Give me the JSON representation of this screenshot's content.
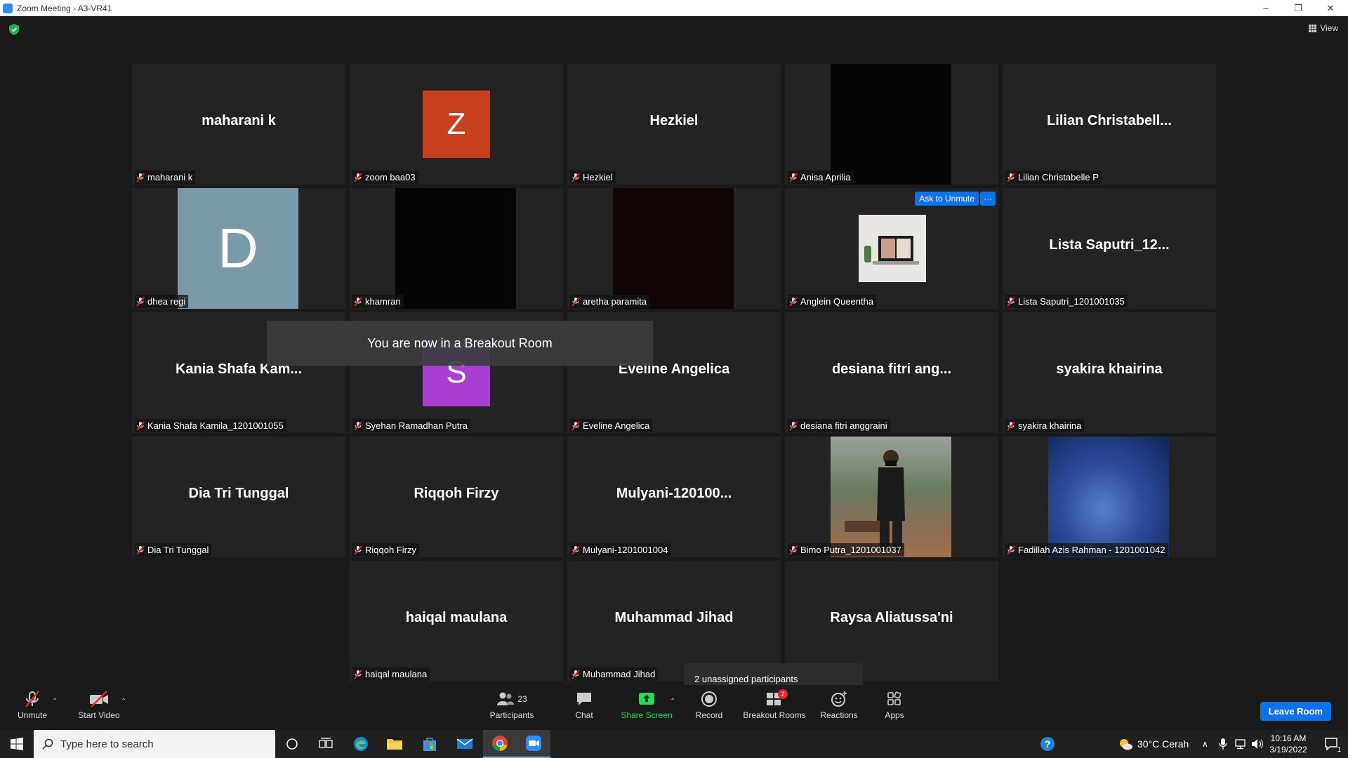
{
  "window": {
    "title": "Zoom Meeting - A3-VR41",
    "controls": {
      "minimize": "–",
      "restore": "❐",
      "close": "✕"
    }
  },
  "top": {
    "view_label": "View"
  },
  "tiles": [
    {
      "big_name": "maharani k",
      "label": "maharani k",
      "avatar": null
    },
    {
      "big_name": "",
      "label": "zoom baa03",
      "avatar": {
        "letter": "Z",
        "color": "#c8401b"
      }
    },
    {
      "big_name": "Hezkiel",
      "label": "Hezkiel",
      "avatar": null
    },
    {
      "big_name": "",
      "label": "Anisa Aprilia",
      "video": "black"
    },
    {
      "big_name": "Lilian  Christabell...",
      "label": "Lilian Christabelle P",
      "avatar": null
    },
    {
      "big_name": "",
      "label": "dhea regi",
      "avatar": {
        "letter": "D",
        "color": "#7a9aa8"
      }
    },
    {
      "big_name": "",
      "label": "khamran",
      "video": "black"
    },
    {
      "big_name": "",
      "label": "aretha paramita",
      "video": "darkred"
    },
    {
      "big_name": "",
      "label": "Anglein Queentha",
      "video": "laptop",
      "ask_unmute": "Ask to Unmute",
      "more": "···"
    },
    {
      "big_name": "Lista  Saputri_12...",
      "label": "Lista Saputri_1201001035",
      "avatar": null
    },
    {
      "big_name": "Kania  Shafa  Kam...",
      "label": "Kania Shafa Kamila_1201001055",
      "avatar": null
    },
    {
      "big_name": "",
      "label": "Syehan Ramadhan Putra",
      "avatar": {
        "letter": "S",
        "color": "#a83fd0"
      }
    },
    {
      "big_name": "Eveline Angelica",
      "label": "Eveline Angelica",
      "avatar": null
    },
    {
      "big_name": "desiana fitri ang...",
      "label": "desiana fitri anggraini",
      "avatar": null
    },
    {
      "big_name": "syakira khairina",
      "label": "syakira khairina",
      "avatar": null
    },
    {
      "big_name": "Dia Tri Tunggal",
      "label": "Dia Tri Tunggal",
      "avatar": null
    },
    {
      "big_name": "Riqqoh Firzy",
      "label": "Riqqoh Firzy",
      "avatar": null
    },
    {
      "big_name": "Mulyani-120100...",
      "label": "Mulyani-1201001004",
      "avatar": null
    },
    {
      "big_name": "",
      "label": "Bimo Putra_1201001037",
      "video": "person"
    },
    {
      "big_name": "",
      "label": "Fadillah Azis Rahman - 1201001042",
      "video": "blue"
    },
    {
      "big_name": "haiqal maulana",
      "label": "haiqal maulana",
      "avatar": null
    },
    {
      "big_name": "Muhammad Jihad",
      "label": "Muhammad Jihad",
      "avatar": null
    },
    {
      "big_name": "Raysa Aliatussa'ni",
      "label": "'ni",
      "avatar": null
    }
  ],
  "toast": "You are now in a Breakout Room",
  "tooltip": "2 unassigned participants",
  "toolbar": {
    "unmute": "Unmute",
    "start_video": "Start Video",
    "participants": "Participants",
    "participants_count": "23",
    "chat": "Chat",
    "share_screen": "Share Screen",
    "record": "Record",
    "breakout_rooms": "Breakout Rooms",
    "breakout_badge": "2",
    "reactions": "Reactions",
    "apps": "Apps",
    "leave": "Leave Room",
    "share_color": "#23d959"
  },
  "taskbar": {
    "search_placeholder": "Type here to search",
    "weather": "30°C  Cerah",
    "time": "10:16 AM",
    "date": "3/19/2022",
    "notification_count": "1"
  }
}
